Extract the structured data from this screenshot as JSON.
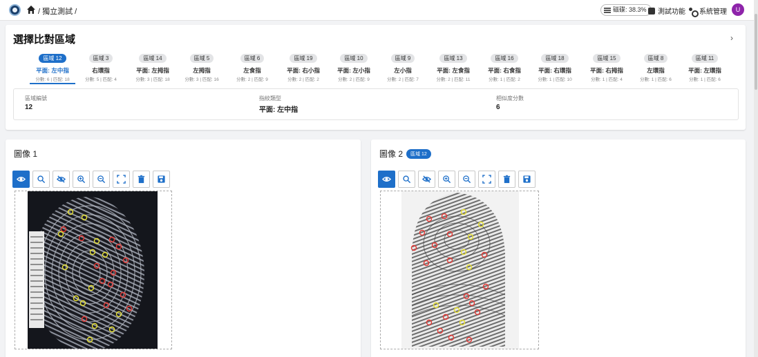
{
  "header": {
    "breadcrumb": "/ 獨立測試 /",
    "storage_label": "磁碟: 38.3%",
    "nav": [
      {
        "label": "測試功能"
      },
      {
        "label": "系統管理"
      }
    ],
    "avatar_initial": "U"
  },
  "region_section": {
    "title": "選擇比對區域",
    "tabs": [
      {
        "badge": "區域 12",
        "label": "平面: 左中指",
        "sub": "分數: 6 | 匹配: 18",
        "active": true
      },
      {
        "badge": "區域 3",
        "label": "右環指",
        "sub": "分數: 5 | 匹配: 4"
      },
      {
        "badge": "區域 14",
        "label": "平面: 左拇指",
        "sub": "分數: 3 | 匹配: 18"
      },
      {
        "badge": "區域 5",
        "label": "左拇指",
        "sub": "分數: 3 | 匹配: 16"
      },
      {
        "badge": "區域 6",
        "label": "左食指",
        "sub": "分數: 2 | 匹配: 9"
      },
      {
        "badge": "區域 19",
        "label": "平面: 右小指",
        "sub": "分數: 2 | 匹配: 2"
      },
      {
        "badge": "區域 10",
        "label": "平面: 左小指",
        "sub": "分數: 2 | 匹配: 9"
      },
      {
        "badge": "區域 9",
        "label": "左小指",
        "sub": "分數: 2 | 匹配: 7"
      },
      {
        "badge": "區域 13",
        "label": "平面: 左食指",
        "sub": "分數: 2 | 匹配: 11"
      },
      {
        "badge": "區域 16",
        "label": "平面: 右食指",
        "sub": "分數: 1 | 匹配: 2"
      },
      {
        "badge": "區域 18",
        "label": "平面: 右環指",
        "sub": "分數: 1 | 匹配: 10"
      },
      {
        "badge": "區域 15",
        "label": "平面: 右拇指",
        "sub": "分數: 1 | 匹配: 4"
      },
      {
        "badge": "區域 8",
        "label": "左環指",
        "sub": "分數: 1 | 匹配: 6"
      },
      {
        "badge": "區域 11",
        "label": "平面: 左環指",
        "sub": "分數: 1 | 匹配: 6"
      }
    ],
    "info": {
      "region_no_label": "區域編號",
      "region_no": "12",
      "finger_type_label": "指紋類型",
      "finger_type": "平面: 左中指",
      "similarity_label": "相似度分數",
      "similarity": "6"
    }
  },
  "image1": {
    "title": "圖像 1"
  },
  "image2": {
    "title": "圖像 2",
    "badge": "區域 12"
  },
  "toolbar_icons": [
    "eye-icon",
    "search-icon",
    "eye-off-icon",
    "zoom-in-icon",
    "zoom-out-icon",
    "fit-screen-icon",
    "delete-icon",
    "save-icon"
  ],
  "colors": {
    "primary": "#1e6fc9",
    "avatar": "#8e24aa",
    "marker_red": "#e53935",
    "marker_yellow": "#e8e233"
  }
}
